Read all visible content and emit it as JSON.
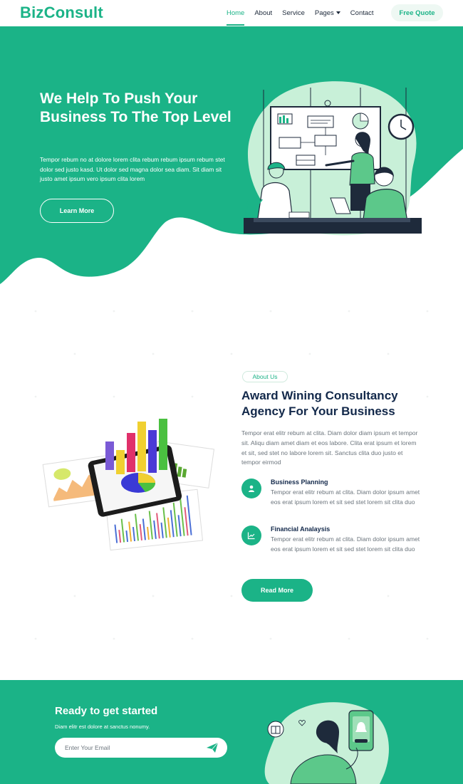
{
  "nav": {
    "brand": "BizConsult",
    "links": [
      {
        "label": "Home",
        "active": true
      },
      {
        "label": "About"
      },
      {
        "label": "Service"
      },
      {
        "label": "Pages",
        "dropdown": true
      },
      {
        "label": "Contact"
      }
    ],
    "cta": "Free Quote"
  },
  "hero": {
    "title": "We Help To Push Your Business To The Top Level",
    "text": "Tempor rebum no at dolore lorem clita rebum rebum ipsum rebum stet dolor sed justo kasd. Ut dolor sed magna dolor sea diam. Sit diam sit justo amet ipsum vero ipsum clita lorem",
    "button": "Learn More"
  },
  "about": {
    "pill": "About Us",
    "title": "Award Wining Consultancy Agency For Your Business",
    "text": "Tempor erat elitr rebum at clita. Diam dolor diam ipsum et tempor sit. Aliqu diam amet diam et eos labore. Clita erat ipsum et lorem et sit, sed stet no labore lorem sit. Sanctus clita duo justo et tempor eirmod",
    "features": [
      {
        "icon": "user-icon",
        "title": "Business Planning",
        "text": "Tempor erat elitr rebum at clita. Diam dolor ipsum amet eos erat ipsum lorem et sit sed stet lorem sit clita duo"
      },
      {
        "icon": "chart-line-icon",
        "title": "Financial Analaysis",
        "text": "Tempor erat elitr rebum at clita. Diam dolor ipsum amet eos erat ipsum lorem et sit sed stet lorem sit clita duo"
      }
    ],
    "button": "Read More"
  },
  "newsletter": {
    "title": "Ready to get started",
    "subtitle": "Diam elitr est dolore at sanctus nonumy.",
    "placeholder": "Enter Your Email",
    "send_icon": "paper-plane-icon"
  },
  "colors": {
    "primary": "#1bb387",
    "dark": "#12284a",
    "text": "#6c757d",
    "light_green": "#c8f0d8"
  }
}
